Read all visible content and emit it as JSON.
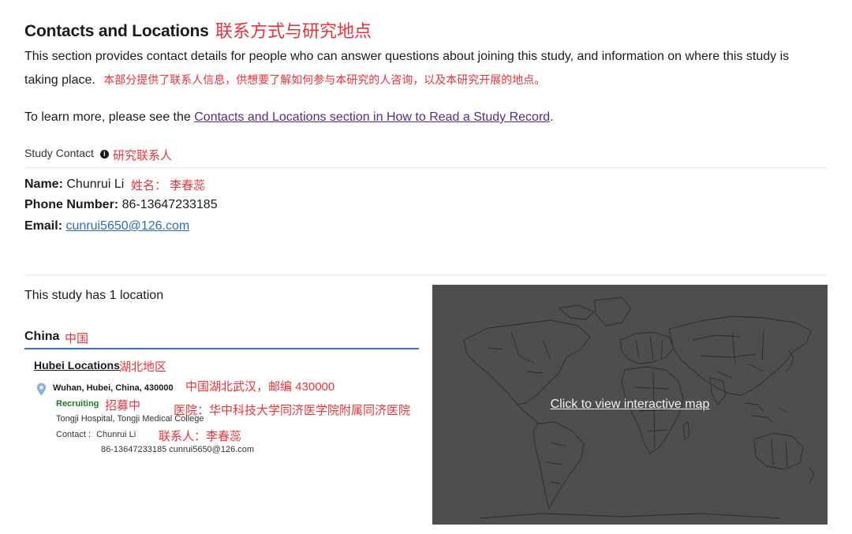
{
  "section": {
    "title": "Contacts and Locations",
    "title_cn": "联系方式与研究地点",
    "description": "This section provides contact details for people who can answer questions about joining this study, and information on where this study is",
    "description_line2": "taking place.",
    "description_cn": "本部分提供了联系人信息，供想要了解如何参与本研究的人咨询，以及本研究开展的地点。",
    "learn_more_prefix": "To learn more, please see the",
    "learn_more_link": "Contacts and Locations section in How to Read a Study Record",
    "learn_more_suffix": "."
  },
  "study_contact": {
    "heading": "Study Contact",
    "info_icon": "i",
    "heading_cn": "研究联系人",
    "name_label": "Name:",
    "name_value": "Chunrui Li",
    "name_cn": "姓名： 李春蕊",
    "phone_label": "Phone Number:",
    "phone_value": "86-13647233185",
    "email_label": "Email:",
    "email_value": "cunrui5650@126.com"
  },
  "locations": {
    "count_text": "This study has 1 location",
    "country": "China",
    "country_cn": "中国",
    "region": "Hubei Locations",
    "region_cn": "湖北地区",
    "city": "Wuhan, Hubei, China, 430000",
    "city_cn": "中国湖北武汉，邮编 430000",
    "status": "Recruiting",
    "status_cn": "招募中",
    "hospital_cn": "医院：华中科技大学同济医学院附属同济医院",
    "hospital": "Tongji Hospital, Tongji Medical College",
    "contact_label": "Contact :",
    "contact_name": "Chunrui Li",
    "contact_cn": "联系人：李春蕊",
    "contact_details": "86-13647233185 cunrui5650@126.com"
  },
  "map": {
    "link_text": "Click to view interactive map",
    "background_color": "#4e4e4e"
  },
  "colors": {
    "accent_blue": "#2a78c6",
    "annotation_red": "#e8333a",
    "link_purple": "#5a2a86",
    "status_green": "#1e7a2e"
  }
}
